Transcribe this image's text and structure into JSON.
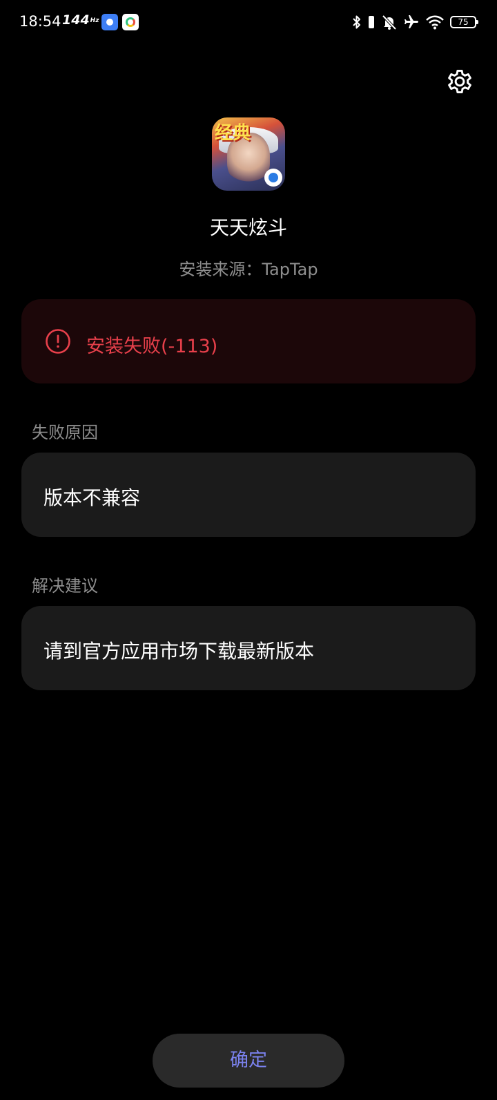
{
  "status_bar": {
    "time": "18:54",
    "refresh_rate": "144",
    "refresh_unit": "Hz",
    "battery": "75"
  },
  "app": {
    "name": "天天炫斗",
    "install_source": "安装来源：TapTap",
    "icon_badge": "经典"
  },
  "error": {
    "message": "安装失败(-113)"
  },
  "failure_reason": {
    "label": "失败原因",
    "text": "版本不兼容"
  },
  "solution": {
    "label": "解决建议",
    "text": "请到官方应用市场下载最新版本"
  },
  "confirm_label": "确定",
  "colors": {
    "background": "#000000",
    "error_red": "#e8404b",
    "error_card": "#1c0709",
    "card": "#1b1b1b",
    "muted_text": "#8e8e8e",
    "button_text": "#7b82ee",
    "button_bg": "#2a2a2a"
  },
  "icons": [
    "settings-gear-icon",
    "error-circle-icon",
    "bluetooth-icon",
    "vibrate-icon",
    "mute-bell-icon",
    "airplane-icon",
    "wifi-icon",
    "battery-icon"
  ]
}
